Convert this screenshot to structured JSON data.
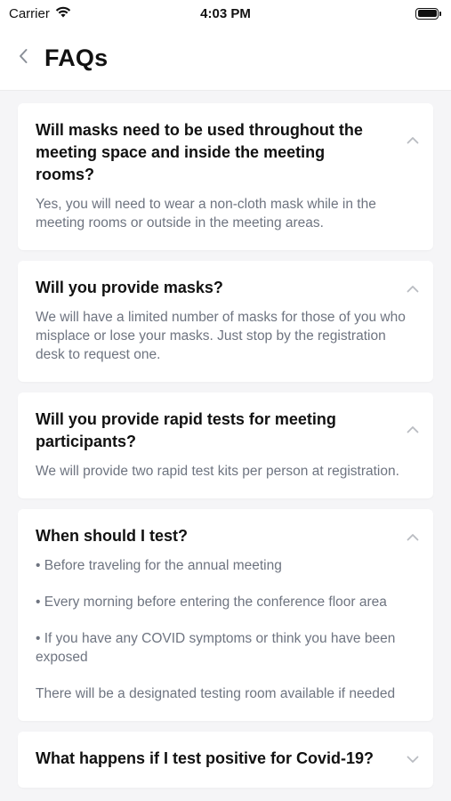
{
  "status_bar": {
    "carrier": "Carrier",
    "time": "4:03 PM"
  },
  "header": {
    "title": "FAQs"
  },
  "faqs": [
    {
      "question": "Will masks need to be used throughout the meeting space and inside the meeting rooms?",
      "answer": [
        "Yes, you will need to wear a non-cloth mask while in the meeting rooms or outside in the meeting areas."
      ],
      "expanded": true
    },
    {
      "question": "Will you provide masks?",
      "answer": [
        "We will have a limited number of masks for those of you who misplace or lose your masks. Just stop by the registration desk to request one."
      ],
      "expanded": true
    },
    {
      "question": "Will you provide rapid tests for meeting participants?",
      "answer": [
        "We will provide two rapid test kits per person at registration."
      ],
      "expanded": true
    },
    {
      "question": "When should I test?",
      "answer": [
        "• Before traveling for the annual meeting",
        " • Every morning before entering the conference floor area",
        " • If you have any COVID symptoms or think you have been exposed",
        " There will be a designated testing room available if needed"
      ],
      "expanded": true
    },
    {
      "question": "What happens if I test positive for Covid-19?",
      "answer": [],
      "expanded": false
    }
  ],
  "colors": {
    "background": "#f5f5f7",
    "card": "#ffffff",
    "answer_text": "#6e7480",
    "chevron": "#b9bcc2"
  },
  "icons": {
    "back": "chevron-left-icon",
    "collapse": "chevron-up-icon",
    "expand": "chevron-down-icon",
    "wifi": "wifi-icon",
    "battery": "battery-icon"
  }
}
